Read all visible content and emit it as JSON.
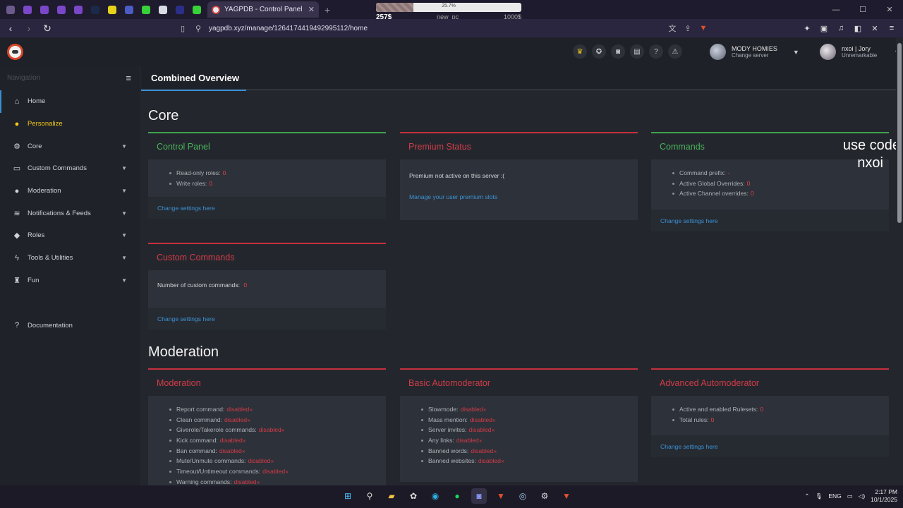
{
  "browser": {
    "tab_title": "YAGPDB - Control Panel | MODY",
    "url": "yagpdb.xyz/manage/1264174419492995112/home",
    "pinned_colors": [
      "#6b5a8c",
      "#7a47c9",
      "#7a47c9",
      "#7a47c9",
      "#7a47c9",
      "#1b2a48",
      "#e6d21a",
      "#4b5cc4",
      "#37d23a",
      "#d8dde4",
      "#2c2f8a",
      "#37d23a"
    ]
  },
  "overlay": {
    "percent_text": "25.7%",
    "progress": 0.257,
    "current": "257$",
    "center": "new_pc",
    "goal": "1000$"
  },
  "topbar": {
    "server_name": "MODY HOMIES",
    "server_sub": "Change server",
    "user_name": "nxoi | Jory",
    "user_sub": "Unremarkable"
  },
  "sidebar": {
    "nav_label": "Navigation",
    "items": [
      {
        "label": "Home",
        "icon": "home-icon",
        "glyph": "⌂"
      },
      {
        "label": "Personalize",
        "icon": "user-icon",
        "glyph": "●"
      },
      {
        "label": "Core",
        "icon": "cogs-icon",
        "glyph": "⚙"
      },
      {
        "label": "Custom Commands",
        "icon": "terminal-icon",
        "glyph": "▭"
      },
      {
        "label": "Moderation",
        "icon": "user-shield-icon",
        "glyph": "●"
      },
      {
        "label": "Notifications & Feeds",
        "icon": "rss-icon",
        "glyph": "≋"
      },
      {
        "label": "Roles",
        "icon": "tags-icon",
        "glyph": "◆"
      },
      {
        "label": "Tools & Utilities",
        "icon": "bolt-icon",
        "glyph": "ϟ"
      },
      {
        "label": "Fun",
        "icon": "trophy-icon",
        "glyph": "♜"
      }
    ],
    "documentation": "Documentation"
  },
  "page": {
    "tab": "Combined Overview",
    "core_title": "Core",
    "moderation_title": "Moderation"
  },
  "cards": {
    "control_panel": {
      "title": "Control Panel",
      "rows": [
        {
          "label": "Read-only roles:",
          "value": "0"
        },
        {
          "label": "Write roles:",
          "value": "0"
        }
      ],
      "footer": "Change settings here"
    },
    "premium": {
      "title": "Premium Status",
      "text": "Premium not active on this server :(",
      "link": "Manage your user premium slots"
    },
    "commands": {
      "title": "Commands",
      "rows": [
        {
          "label": "Command prefix:",
          "value": "-"
        },
        {
          "label": "Active Global Overrides:",
          "value": "0"
        },
        {
          "label": "Active Channel overrides:",
          "value": "0"
        }
      ],
      "footer": "Change settings here"
    },
    "custom_commands": {
      "title": "Custom Commands",
      "text": "Number of custom commands:",
      "value": "0",
      "footer": "Change settings here"
    },
    "moderation": {
      "title": "Moderation",
      "rows": [
        {
          "label": "Report command:",
          "value": "disabled"
        },
        {
          "label": "Clean command:",
          "value": "disabled"
        },
        {
          "label": "Giverole/Takerole commands:",
          "value": "disabled"
        },
        {
          "label": "Kick command:",
          "value": "disabled"
        },
        {
          "label": "Ban command:",
          "value": "disabled"
        },
        {
          "label": "Mute/Unmute commands:",
          "value": "disabled"
        },
        {
          "label": "Timeout/Untimeout commands:",
          "value": "disabled"
        },
        {
          "label": "Warning commands:",
          "value": "disabled"
        }
      ]
    },
    "basic_automod": {
      "title": "Basic Automoderator",
      "rows": [
        {
          "label": "Slowmode:",
          "value": "disabled"
        },
        {
          "label": "Mass mention:",
          "value": "disabled"
        },
        {
          "label": "Server invites:",
          "value": "disabled"
        },
        {
          "label": "Any links:",
          "value": "disabled"
        },
        {
          "label": "Banned words:",
          "value": "disabled"
        },
        {
          "label": "Banned websites:",
          "value": "disabled"
        }
      ]
    },
    "advanced_automod": {
      "title": "Advanced Automoderator",
      "rows": [
        {
          "label": "Active and enabled Rulesets:",
          "value": "0"
        },
        {
          "label": "Total rules:",
          "value": "0"
        }
      ],
      "footer": "Change settings here"
    }
  },
  "promo": {
    "line1": "use code",
    "line2": "nxoi"
  },
  "taskbar": {
    "lang": "ENG",
    "time": "2:17 PM",
    "date": "10/1/2025"
  }
}
